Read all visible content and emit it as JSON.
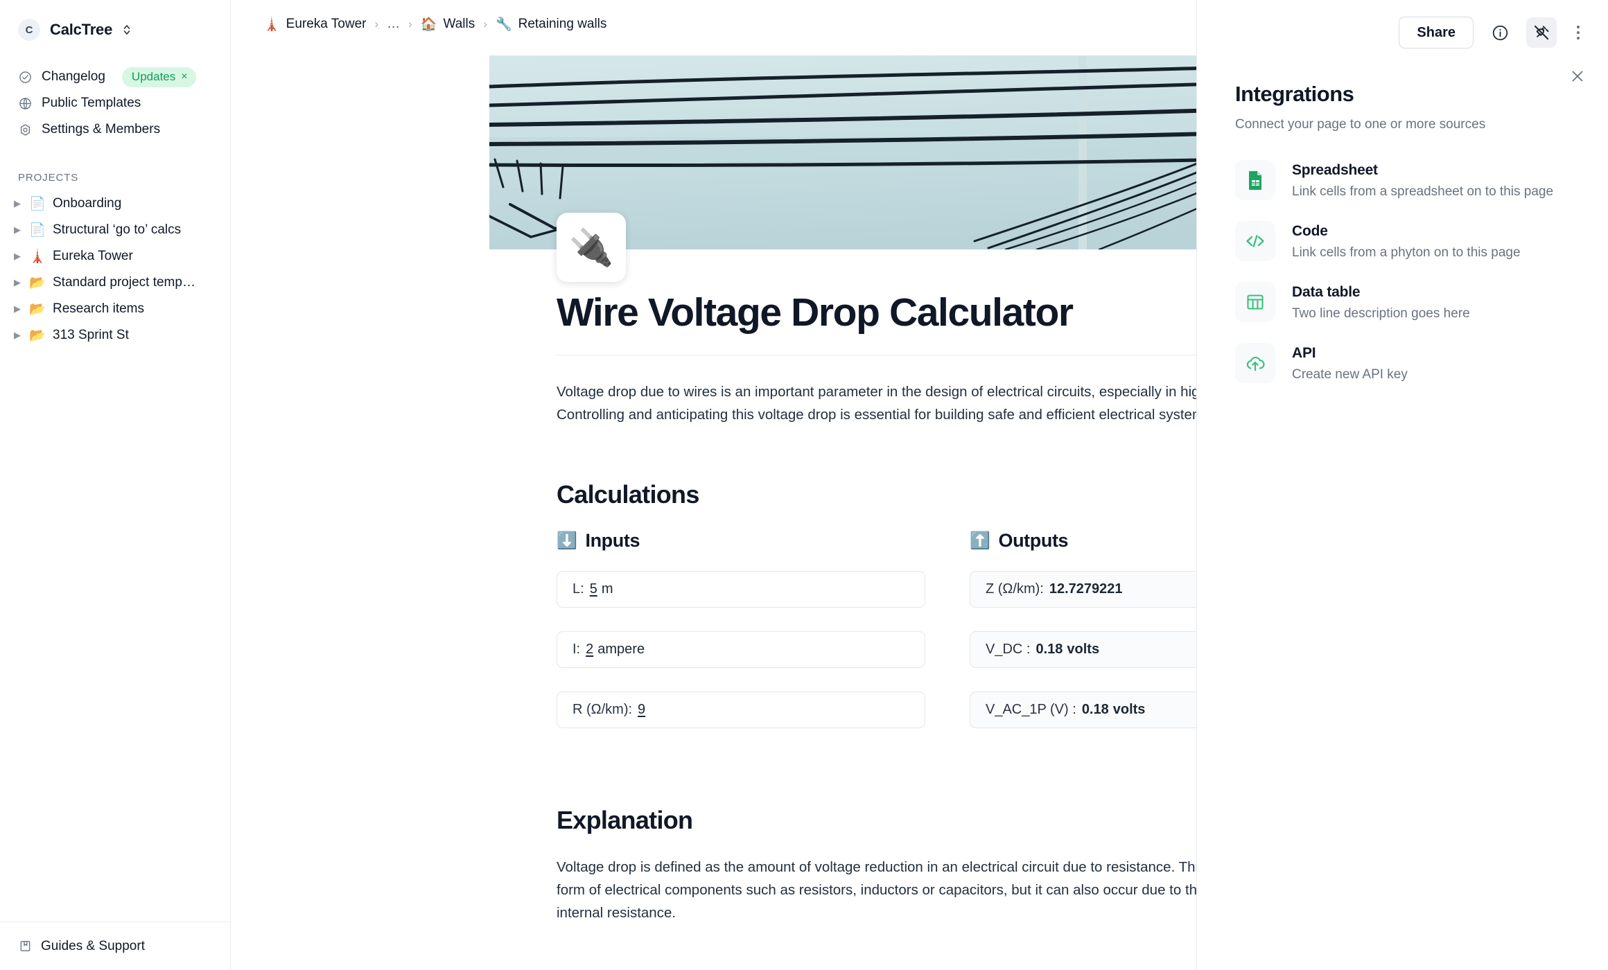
{
  "sidebar": {
    "workspace": {
      "initial": "C",
      "name": "CalcTree"
    },
    "nav": [
      {
        "label": "Changelog",
        "icon": "check-circle-icon",
        "badge": "Updates",
        "badge_close": "×"
      },
      {
        "label": "Public Templates",
        "icon": "globe-icon"
      },
      {
        "label": "Settings & Members",
        "icon": "gear-icon"
      }
    ],
    "projects_title": "PROJECTS",
    "projects": [
      {
        "label": "Onboarding",
        "emoji": "📄"
      },
      {
        "label": "Structural ‘go to’ calcs",
        "emoji": "📄"
      },
      {
        "label": "Eureka Tower",
        "emoji": "🗼"
      },
      {
        "label": "Standard project temp…",
        "emoji": "📂"
      },
      {
        "label": "Research items",
        "emoji": "📂"
      },
      {
        "label": "313 Sprint St",
        "emoji": "📂"
      }
    ],
    "footer": {
      "label": "Guides & Support",
      "icon": "book-icon"
    }
  },
  "breadcrumb": {
    "items": [
      {
        "emoji": "🗼",
        "label": "Eureka Tower"
      },
      {
        "label": "…"
      },
      {
        "emoji": "🏠",
        "label": "Walls"
      },
      {
        "emoji": "🔧",
        "label": "Retaining walls"
      }
    ],
    "separator": "›"
  },
  "page": {
    "icon_emoji": "🔌",
    "title": "Wire Voltage Drop Calculator",
    "intro": "Voltage drop due to wires is an important parameter in the design of electrical circuits, especially in high-voltage systems. Controlling and anticipating this voltage drop is essential for building safe and efficient electrical systems.",
    "calculations_heading": "Calculations",
    "inputs": {
      "emoji": "⬇️",
      "heading": "Inputs",
      "fields": [
        {
          "label": "L:",
          "value": "5",
          "unit": "m"
        },
        {
          "label": "I:",
          "value": "2",
          "unit": "ampere"
        },
        {
          "label": "R (Ω/km):",
          "value": "9",
          "unit": ""
        }
      ]
    },
    "outputs": {
      "emoji": "⬆️",
      "heading": "Outputs",
      "fields": [
        {
          "label": "Z (Ω/km):",
          "value": "12.7279221",
          "unit": ""
        },
        {
          "label": "V_DC :",
          "value": "0.18",
          "unit": "volts"
        },
        {
          "label": "V_AC_1P (V) :",
          "value": "0.18",
          "unit": "volts"
        }
      ]
    },
    "explanation_heading": "Explanation",
    "explanation": "Voltage drop is defined as the amount of voltage reduction in an electrical circuit due to resistance. This resistance can be in the form of electrical components such as resistors, inductors or capacitors, but it can also occur due to the electricity carrying wire's internal resistance."
  },
  "topbar": {
    "share_label": "Share",
    "info_icon": "info-icon",
    "plug_icon": "plug-disconnected-icon",
    "more_icon": "kebab-menu-icon"
  },
  "integrations": {
    "close_icon": "close-icon",
    "title": "Integrations",
    "subtitle": "Connect your page to one or more sources",
    "items": [
      {
        "name": "Spreadsheet",
        "desc": "Link cells from a spreadsheet on to this page",
        "icon": "spreadsheet-icon"
      },
      {
        "name": "Code",
        "desc": "Link cells from a phyton on to this page",
        "icon": "code-icon"
      },
      {
        "name": "Data table",
        "desc": "Two line description goes here",
        "icon": "table-icon"
      },
      {
        "name": "API",
        "desc": "Create new API key",
        "icon": "cloud-upload-icon"
      }
    ]
  },
  "colors": {
    "accent_green": "#0f9d58",
    "badge_bg": "#d7f6e4",
    "text": "#101828",
    "muted": "#6a7280",
    "border": "#e9eaec"
  }
}
